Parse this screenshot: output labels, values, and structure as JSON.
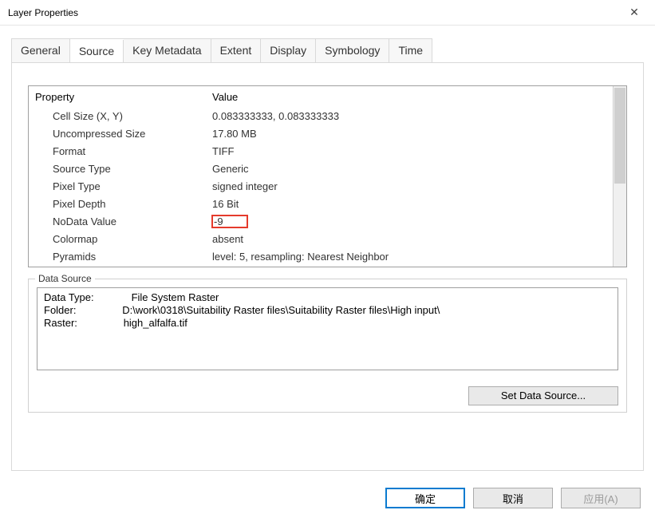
{
  "window": {
    "title": "Layer Properties"
  },
  "tabs": [
    {
      "label": "General"
    },
    {
      "label": "Source"
    },
    {
      "label": "Key Metadata"
    },
    {
      "label": "Extent"
    },
    {
      "label": "Display"
    },
    {
      "label": "Symbology"
    },
    {
      "label": "Time"
    }
  ],
  "propgrid": {
    "headers": {
      "property": "Property",
      "value": "Value"
    },
    "rows": [
      {
        "p": "Cell Size (X, Y)",
        "v": "0.083333333, 0.083333333"
      },
      {
        "p": "Uncompressed Size",
        "v": "17.80 MB"
      },
      {
        "p": "Format",
        "v": "TIFF"
      },
      {
        "p": "Source Type",
        "v": "Generic"
      },
      {
        "p": "Pixel Type",
        "v": "signed integer"
      },
      {
        "p": "Pixel Depth",
        "v": "16 Bit"
      },
      {
        "p": "NoData Value",
        "v": "-9",
        "hl": true
      },
      {
        "p": "Colormap",
        "v": "absent"
      },
      {
        "p": "Pyramids",
        "v": "level: 5, resampling: Nearest Neighbor"
      }
    ]
  },
  "datasource": {
    "legend": "Data Source",
    "lines": [
      "Data Type:             File System Raster",
      "Folder:                D:\\work\\0318\\Suitability Raster files\\Suitability Raster files\\High input\\",
      "Raster:                high_alfalfa.tif"
    ],
    "set_btn": "Set Data Source..."
  },
  "buttons": {
    "ok": "确定",
    "cancel": "取消",
    "apply": "应用(A)"
  }
}
